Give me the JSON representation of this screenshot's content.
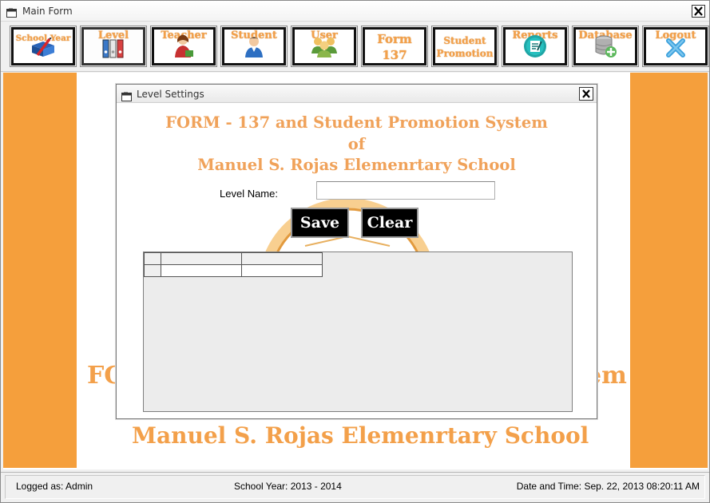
{
  "window": {
    "title": "Main Form",
    "icon": "form-icon",
    "close_icon": "close-icon"
  },
  "toolbar": {
    "buttons": [
      {
        "label": "School Year",
        "icon": "book-pencil-icon"
      },
      {
        "label": "Level",
        "icon": "binders-icon"
      },
      {
        "label": "Teacher",
        "icon": "teacher-icon"
      },
      {
        "label": "Student",
        "icon": "student-icon"
      },
      {
        "label": "User",
        "icon": "users-icon"
      },
      {
        "label": "Form 137",
        "line1": "Form",
        "line2": "137",
        "icon": ""
      },
      {
        "label": "Student Promotion",
        "line1": "Student",
        "line2": "Promotion",
        "icon": ""
      },
      {
        "label": "Reports",
        "icon": "report-icon"
      },
      {
        "label": "Database",
        "icon": "database-icon"
      },
      {
        "label": "Logout",
        "icon": "logout-x-icon"
      }
    ]
  },
  "background": {
    "line1_left": "FC",
    "line1_right": "em",
    "line2": "Manuel S. Rojas Elemenrtary School",
    "accent": "#f59f3c"
  },
  "dialog": {
    "title": "Level Settings",
    "header": {
      "line1": "FORM - 137 and Student Promotion System",
      "line2": "of",
      "line3": "Manuel S. Rojas Elemenrtary School"
    },
    "level_name_label": "Level Name:",
    "level_name_value": "",
    "save_label": "Save",
    "clear_label": "Clear",
    "grid": {
      "columns": [
        "",
        ""
      ],
      "rows": [
        [
          "",
          ""
        ]
      ]
    }
  },
  "status": {
    "logged_as": "Logged as: Admin",
    "school_year": "School Year: 2013 - 2014",
    "date_time": "Date and Time: Sep. 22, 2013 08:20:11 AM"
  },
  "colors": {
    "orange_text": "#f3a04a",
    "button_bg": "#000000"
  }
}
